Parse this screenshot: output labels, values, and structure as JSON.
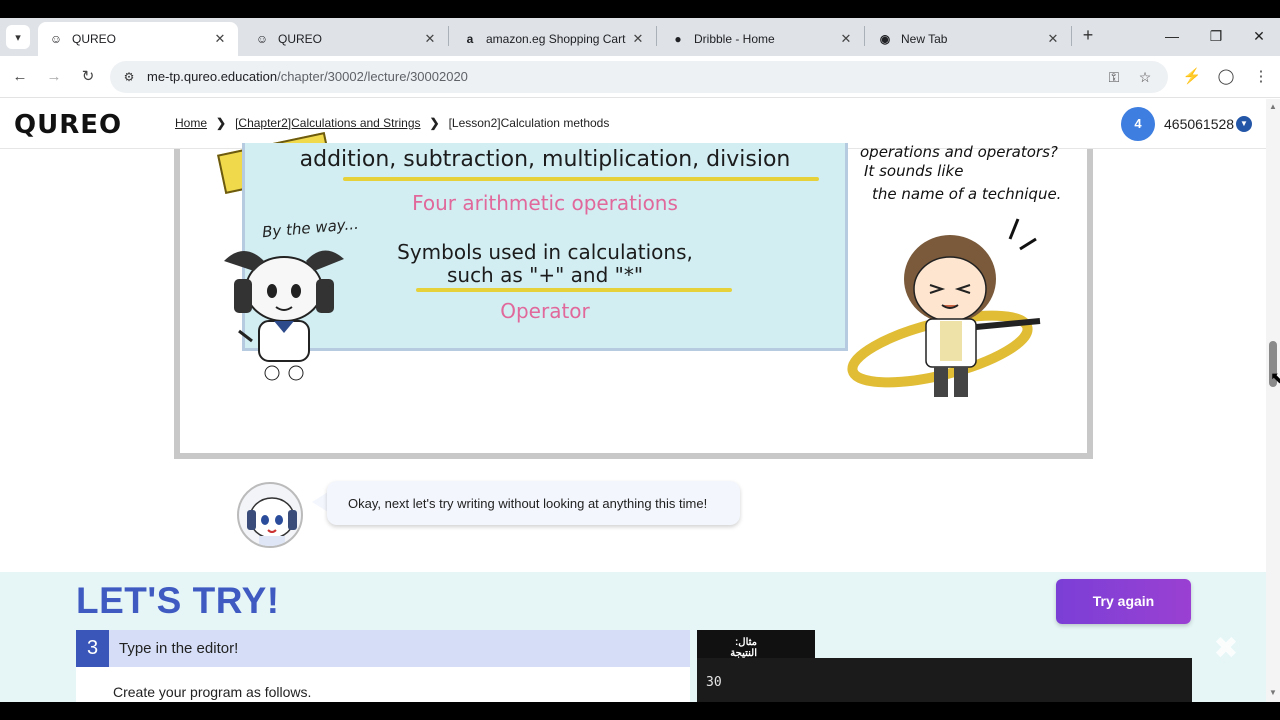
{
  "browser": {
    "tabs": [
      {
        "title": "QUREO",
        "icon": "qureo-favicon",
        "active": true
      },
      {
        "title": "QUREO",
        "icon": "qureo-favicon",
        "active": false
      },
      {
        "title": "amazon.eg Shopping Cart",
        "icon": "amazon-favicon",
        "active": false
      },
      {
        "title": "Dribble - Home",
        "icon": "globe-icon",
        "active": false
      },
      {
        "title": "New Tab",
        "icon": "chrome-icon",
        "active": false
      }
    ],
    "url_host": "me-tp.qureo.education",
    "url_path": "/chapter/30002/lecture/30002020"
  },
  "header": {
    "logo": "QUREO",
    "breadcrumb": {
      "home": "Home",
      "chapter": "[Chapter2]Calculations and Strings",
      "lesson": "[Lesson2]Calculation methods"
    },
    "user": {
      "badge": "4",
      "id": "465061528"
    }
  },
  "comic": {
    "line1": "addition, subtraction, multiplication, division",
    "line1_caption": "Four arithmetic operations",
    "line2a": "Symbols used in calculations,",
    "line2b": "such as \"+\" and \"*\"",
    "line2_caption": "Operator",
    "aside": "By the way...",
    "shout1": "operations and operators?",
    "shout2": "It sounds like",
    "shout3": "the name of a technique."
  },
  "speech": {
    "text": "Okay, next let's try writing without looking at anything this time!"
  },
  "lets_try": {
    "heading": "LET'S TRY!",
    "try_again": "Try again",
    "step_number": "3",
    "step_text": "Type in the editor!",
    "step_desc": "Create your program as follows.",
    "example_tab": "مثال: النتيجة",
    "console_output": "30"
  },
  "colors": {
    "accent_blue": "#3f5bc2",
    "try_again_purple": "#7b3fd6",
    "board_cyan": "#d2eef3",
    "highlight_yellow": "#e6d13b",
    "caption_pink": "#e0689a"
  }
}
